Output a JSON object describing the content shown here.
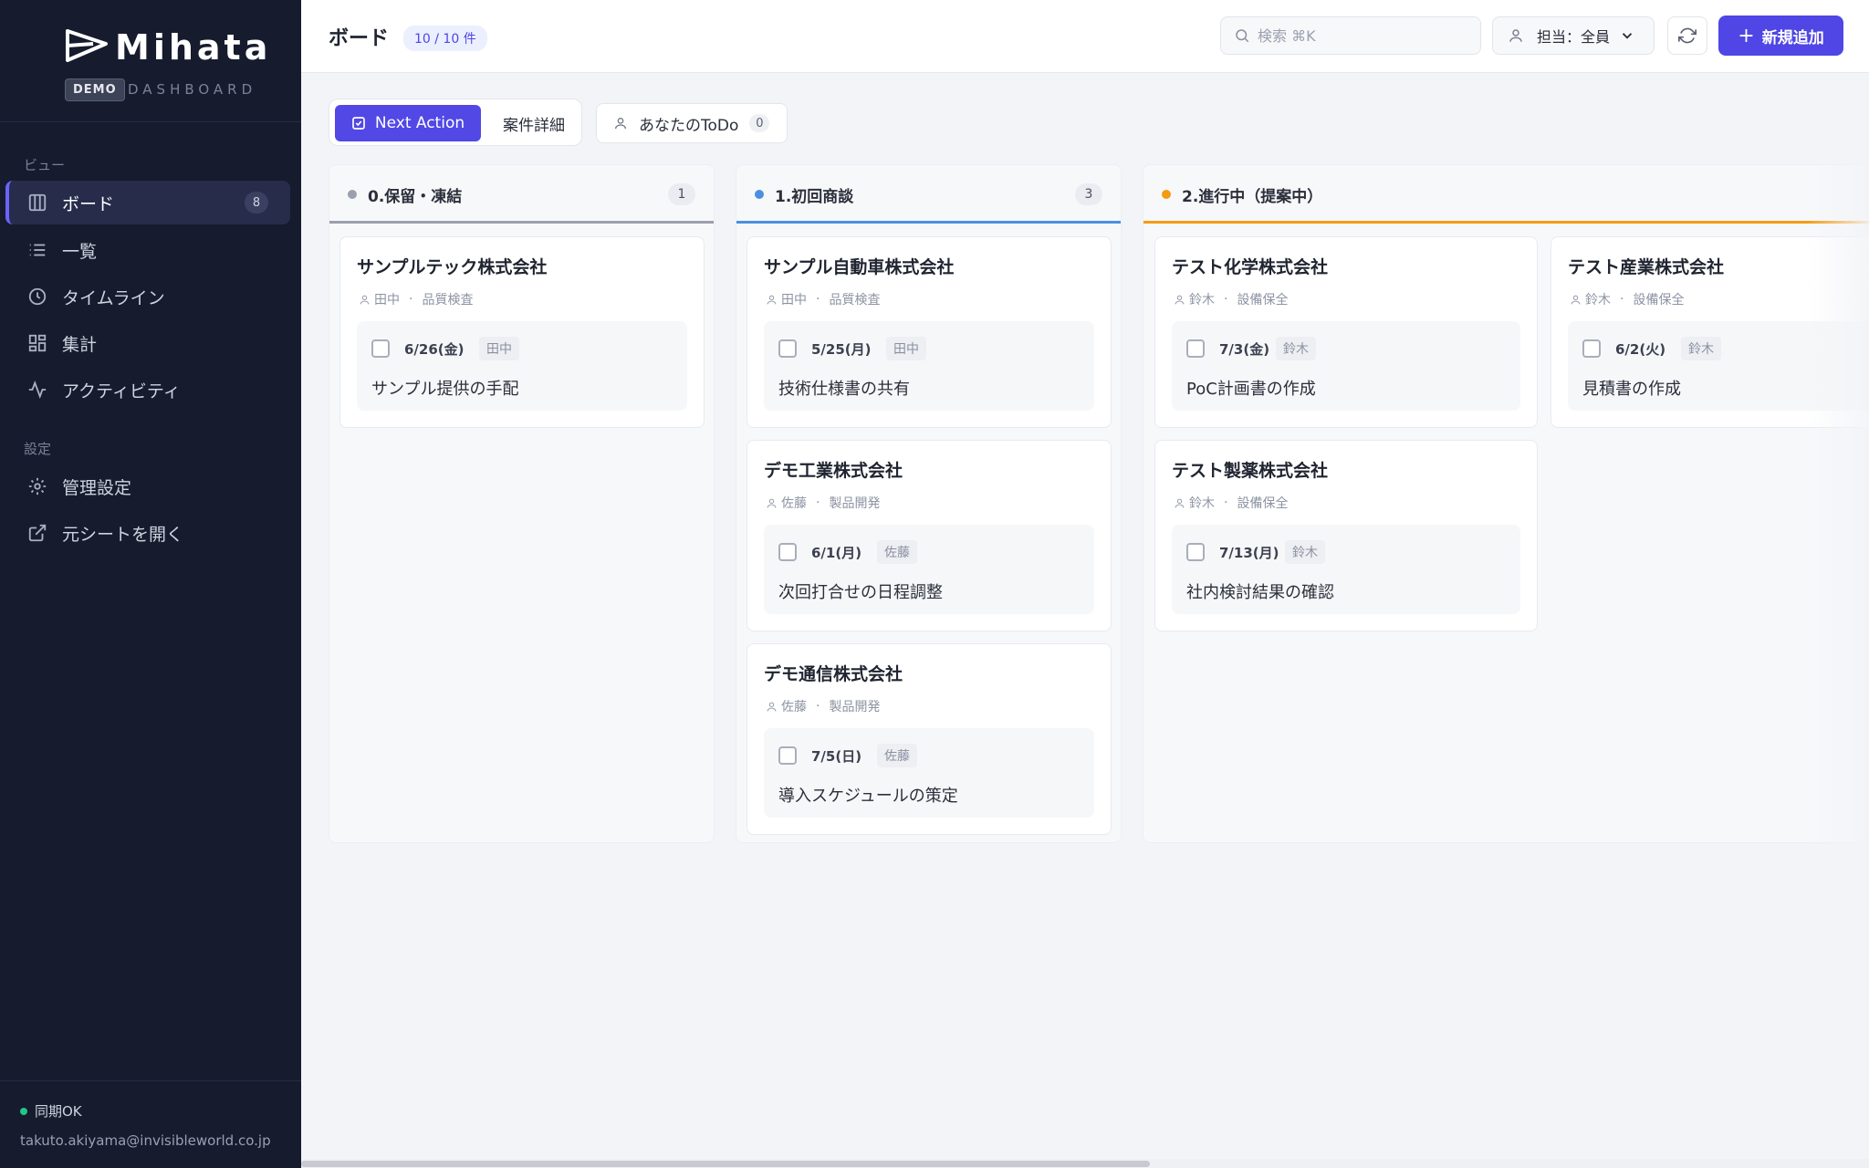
{
  "app": {
    "name": "Mihata",
    "badge": "DEMO",
    "subtitle": "DASHBOARD"
  },
  "sidebar": {
    "section_view": "ビュー",
    "section_settings": "設定",
    "items": [
      {
        "label": "ボード",
        "count": "8",
        "icon": "board-icon"
      },
      {
        "label": "一覧",
        "icon": "list-icon"
      },
      {
        "label": "タイムライン",
        "icon": "clock-icon"
      },
      {
        "label": "集計",
        "icon": "grid-icon"
      },
      {
        "label": "アクティビティ",
        "icon": "activity-icon"
      }
    ],
    "settings_items": [
      {
        "label": "管理設定",
        "icon": "gear-icon"
      },
      {
        "label": "元シートを開く",
        "icon": "external-link-icon"
      }
    ],
    "sync_status": "同期OK",
    "user_email": "takuto.akiyama@invisibleworld.co.jp"
  },
  "header": {
    "title": "ボード",
    "count_badge": "10 / 10 件",
    "search_placeholder": "検索 ⌘K",
    "assignee_filter": "担当：全員",
    "add_button": "新規追加"
  },
  "tabs": {
    "next_action": "Next Action",
    "details": "案件詳細",
    "todo_label": "あなたのToDo",
    "todo_count": "0"
  },
  "colors": {
    "accent": "#4f46e5",
    "column0": "#9aa0ad",
    "column1": "#4a90e2",
    "column2": "#f39c12"
  },
  "columns": [
    {
      "title": "0.保留・凍結",
      "count": "1",
      "cards": [
        {
          "company": "サンプルテック株式会社",
          "owner": "田中",
          "dept": "品質検査",
          "date": "6/26(金)",
          "task_owner": "田中",
          "task": "サンプル提供の手配"
        }
      ]
    },
    {
      "title": "1.初回商談",
      "count": "3",
      "cards": [
        {
          "company": "サンプル自動車株式会社",
          "owner": "田中",
          "dept": "品質検査",
          "date": "5/25(月)",
          "task_owner": "田中",
          "task": "技術仕様書の共有"
        },
        {
          "company": "デモ工業株式会社",
          "owner": "佐藤",
          "dept": "製品開発",
          "date": "6/1(月)",
          "task_owner": "佐藤",
          "task": "次回打合せの日程調整"
        },
        {
          "company": "デモ通信株式会社",
          "owner": "佐藤",
          "dept": "製品開発",
          "date": "7/5(日)",
          "task_owner": "佐藤",
          "task": "導入スケジュールの策定"
        }
      ]
    },
    {
      "title": "2.進行中（提案中）",
      "count": "",
      "cards": [
        {
          "company": "テスト化学株式会社",
          "owner": "鈴木",
          "dept": "設備保全",
          "date": "7/3(金)",
          "task_owner": "鈴木",
          "task": "PoC計画書の作成"
        },
        {
          "company": "テスト産業株式会社",
          "owner": "鈴木",
          "dept": "設備保全",
          "date": "6/2(火)",
          "task_owner": "鈴木",
          "task": "見積書の作成"
        },
        {
          "company": "テスト製薬株式会社",
          "owner": "鈴木",
          "dept": "設備保全",
          "date": "7/13(月)",
          "task_owner": "鈴木",
          "task": "社内検討結果の確認"
        }
      ]
    }
  ]
}
